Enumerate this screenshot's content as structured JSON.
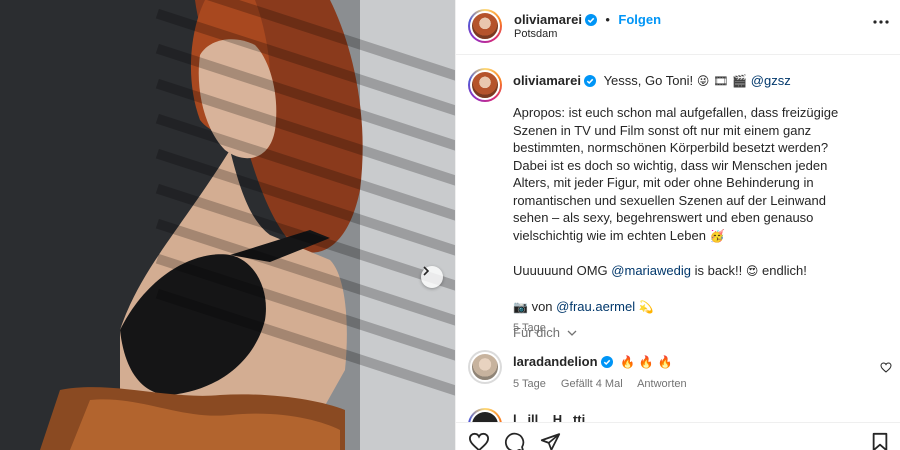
{
  "post": {
    "author": "oliviamarei",
    "follow_label": "Folgen",
    "separator": "•",
    "location": "Potsdam"
  },
  "caption": {
    "author": "oliviamarei",
    "headline": "Yesss, Go Toni!",
    "headline_emoji": "😜 🎞 🎬",
    "headline_mention": "@gzsz",
    "paragraph_1": "Apropos: ist euch schon mal aufgefallen, dass freizügige Szenen in TV und Film sonst oft nur mit einem ganz bestimmten, normschönen Körperbild besetzt werden? Dabei ist es doch so wichtig, dass wir Menschen jeden Alters, mit jeder Figur, mit oder ohne Behinderung in romantischen und sexuellen Szenen auf der Leinwand sehen – als sexy, begehrenswert und eben genauso vielschichtig wie im echten Leben",
    "paragraph_1_emoji": "🥳",
    "line_3_prefix": "Uuuuuund OMG",
    "line_3_mention": "@mariawedig",
    "line_3_suffix": "is back!!",
    "line_3_emoji": "😍",
    "line_3_end": "endlich!",
    "credit_emoji": "📷",
    "credit_prefix": "von",
    "credit_mention": "@frau.aermel",
    "credit_end_emoji": "💫",
    "time": "5 Tage"
  },
  "translate_label": "Für dich",
  "comment": {
    "author": "laradandelion",
    "text": "🔥 🔥 🔥",
    "time": "5 Tage",
    "likes": "Gefällt 4 Mal",
    "reply_label": "Antworten"
  },
  "next_comment_author": "l...ill... H...tti...",
  "icons": [
    "more-icon",
    "verified-icon",
    "heart-icon",
    "comment-icon",
    "share-icon",
    "bookmark-icon",
    "chevron-right-icon",
    "chevron-down-icon"
  ],
  "colors": {
    "accent": "#0095f6",
    "link": "#00376b",
    "muted": "#737373",
    "text": "#262626"
  }
}
